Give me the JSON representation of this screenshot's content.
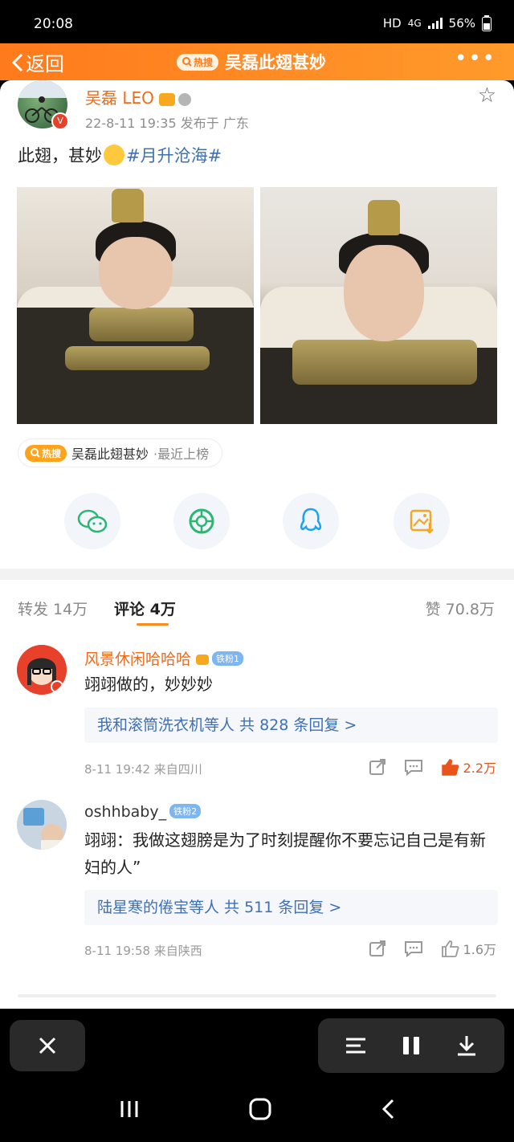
{
  "status_bar": {
    "time": "20:08",
    "network": "HD",
    "signal": "4G",
    "battery": "56%"
  },
  "header": {
    "back_label": "返回",
    "hot_badge": "热搜",
    "title": "吴磊此翅甚妙"
  },
  "post": {
    "author_name": "吴磊 LEO",
    "meta": "22-8-11 19:35  发布于 广东",
    "text": "此翅，甚妙",
    "hashtag": "#月升沧海#",
    "hot_badge": "热搜",
    "hot_topic": "吴磊此翅甚妙",
    "hot_suffix": "·最近上榜"
  },
  "share_icons": [
    "wechat-icon",
    "moments-icon",
    "qq-icon",
    "save-image-icon"
  ],
  "tabs": {
    "repost": "转发 14万",
    "comment": "评论 4万",
    "like": "赞 70.8万"
  },
  "comments": [
    {
      "name": "风景休闲哈哈哈",
      "fan_badge": "铁粉1",
      "text": "翊翊做的，妙妙妙",
      "reply": "我和滚筒洗衣机等人  共 828 条回复 >",
      "meta": "8-11 19:42  来自四川",
      "likes": "2.2万"
    },
    {
      "name": "oshhbaby_",
      "fan_badge": "铁粉2",
      "text": "翊翊：我做这翅膀是为了时刻提醒你不要忘记自己是有新妇的人”",
      "reply": "陆星寒的倦宝等人  共 511 条回复 >",
      "meta": "8-11 19:58  来自陕西",
      "likes": "1.6万"
    }
  ],
  "colors": {
    "accent": "#ff8a1f",
    "name_orange": "#ee6b1a",
    "link_blue": "#3e70b4",
    "hot_red": "#e8541a"
  }
}
